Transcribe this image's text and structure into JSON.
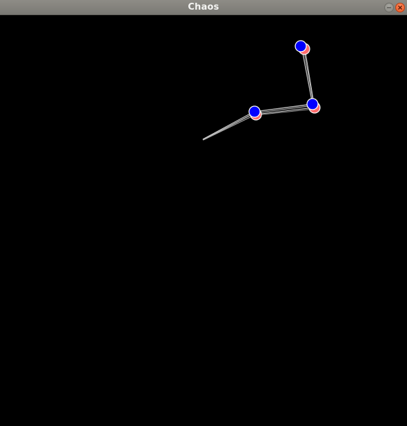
{
  "window": {
    "title": "Chaos",
    "controls": [
      {
        "name": "minimize",
        "icon": "minimize-icon",
        "color": "#8e8d87"
      },
      {
        "name": "close",
        "icon": "close-icon",
        "color": "#e95420"
      }
    ]
  },
  "scene": {
    "background_color": "#000000",
    "rod_color": "#bfbfbf",
    "primary_bob_color": "#0000ff",
    "ghost_bob_color": "#ff5555",
    "bob_outline_color": "#ffffff"
  }
}
